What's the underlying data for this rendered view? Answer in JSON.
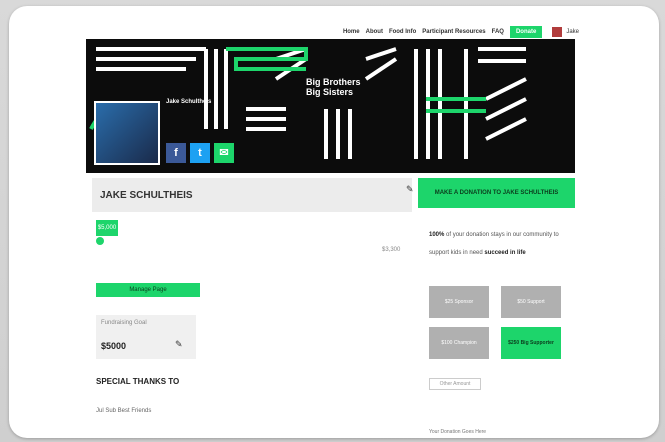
{
  "topnav": {
    "links": [
      "Home",
      "About",
      "Food Info",
      "Participant Resources",
      "FAQ"
    ],
    "donate_label": "Donate",
    "user_label": "Jake"
  },
  "banner": {
    "org_line1": "Big Brothers",
    "org_line2": "Big Sisters",
    "over_name": "Jake Schultheis"
  },
  "profile": {
    "name": "JAKE SCHULTHEIS",
    "badge": "$5,000",
    "raised_right": "$3,300",
    "green_bar_label": "Manage Page",
    "goal_label": "Fundraising Goal",
    "goal_value": "$5000",
    "special_thanks": "SPECIAL THANKS TO",
    "list_link": "Jul Sub Best Friends"
  },
  "right": {
    "header": "MAKE A DONATION TO JAKE SCHULTHEIS",
    "blurb_bold1": "100%",
    "blurb_text": "of your donation stays in our community to support kids in need",
    "blurb_bold2": "succeed in life",
    "tiles": [
      "$25 Sponsor",
      "$50 Support",
      "$100 Champion",
      "$250 Big Supporter"
    ],
    "caption": "Other Amount",
    "footer": "Your Donation Goes Here"
  },
  "colors": {
    "accent": "#1dd56b",
    "banner_bg": "#0c0c0c"
  }
}
